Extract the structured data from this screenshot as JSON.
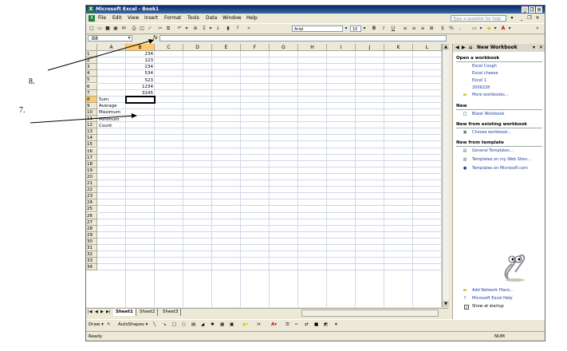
{
  "window": {
    "title": "Microsoft Excel - Book1",
    "controls": [
      "_",
      "❐",
      "✕"
    ]
  },
  "menu": {
    "items": [
      "File",
      "Edit",
      "View",
      "Insert",
      "Format",
      "Tools",
      "Data",
      "Window",
      "Help"
    ],
    "ask_placeholder": "Type a question for help"
  },
  "toolbar": {
    "font_name": "Arial",
    "font_size": "10",
    "bold": "B",
    "italic": "I",
    "underline": "U",
    "currency": "$",
    "percent": "%",
    "comma": ","
  },
  "formula_bar": {
    "name_box": "B8",
    "fx": "fx",
    "content": ""
  },
  "sheet": {
    "columns": [
      "A",
      "B",
      "C",
      "D",
      "E",
      "F",
      "G",
      "H",
      "I",
      "J",
      "K",
      "L"
    ],
    "rows": [
      "1",
      "2",
      "3",
      "4",
      "5",
      "6",
      "7",
      "8",
      "9",
      "10",
      "11",
      "12",
      "13",
      "14",
      "15",
      "16",
      "17",
      "18",
      "19",
      "20",
      "21",
      "22",
      "23",
      "24",
      "25",
      "26",
      "27",
      "28",
      "29",
      "30",
      "31",
      "32",
      "33",
      "34"
    ],
    "b_values": [
      "234",
      "123",
      "234",
      "534",
      "523",
      "1234",
      "3245"
    ],
    "a_labels": [
      "Sum",
      "Average",
      "Maximum",
      "Minimum",
      "Count"
    ],
    "selected_cell": "B8"
  },
  "sheet_tabs": {
    "tabs": [
      "Sheet1",
      "Sheet2",
      "Sheet3"
    ],
    "active": "Sheet1"
  },
  "draw_toolbar": {
    "draw_label": "Draw ▾",
    "autoshapes_label": "AutoShapes ▾"
  },
  "status": {
    "left": "Ready",
    "num": "NUM"
  },
  "task_pane": {
    "title": "New Workbook",
    "open_header": "Open a workbook",
    "recent": [
      "Excel Cough",
      "Excel cheese",
      "Excel 1",
      "2006228"
    ],
    "more_workbooks": "More workbooks...",
    "new_header": "New",
    "blank_workbook": "Blank Workbook",
    "existing_header": "New from existing workbook",
    "choose_workbook": "Choose workbook...",
    "template_header": "New from template",
    "templates": [
      "General Templates...",
      "Templates on my Web Sites...",
      "Templates on Microsoft.com"
    ],
    "add_network": "Add Network Place...",
    "excel_help": "Microsoft Excel Help",
    "show_startup": "Show at startup"
  },
  "annotations": {
    "label_8": "8.",
    "label_7": "7."
  }
}
